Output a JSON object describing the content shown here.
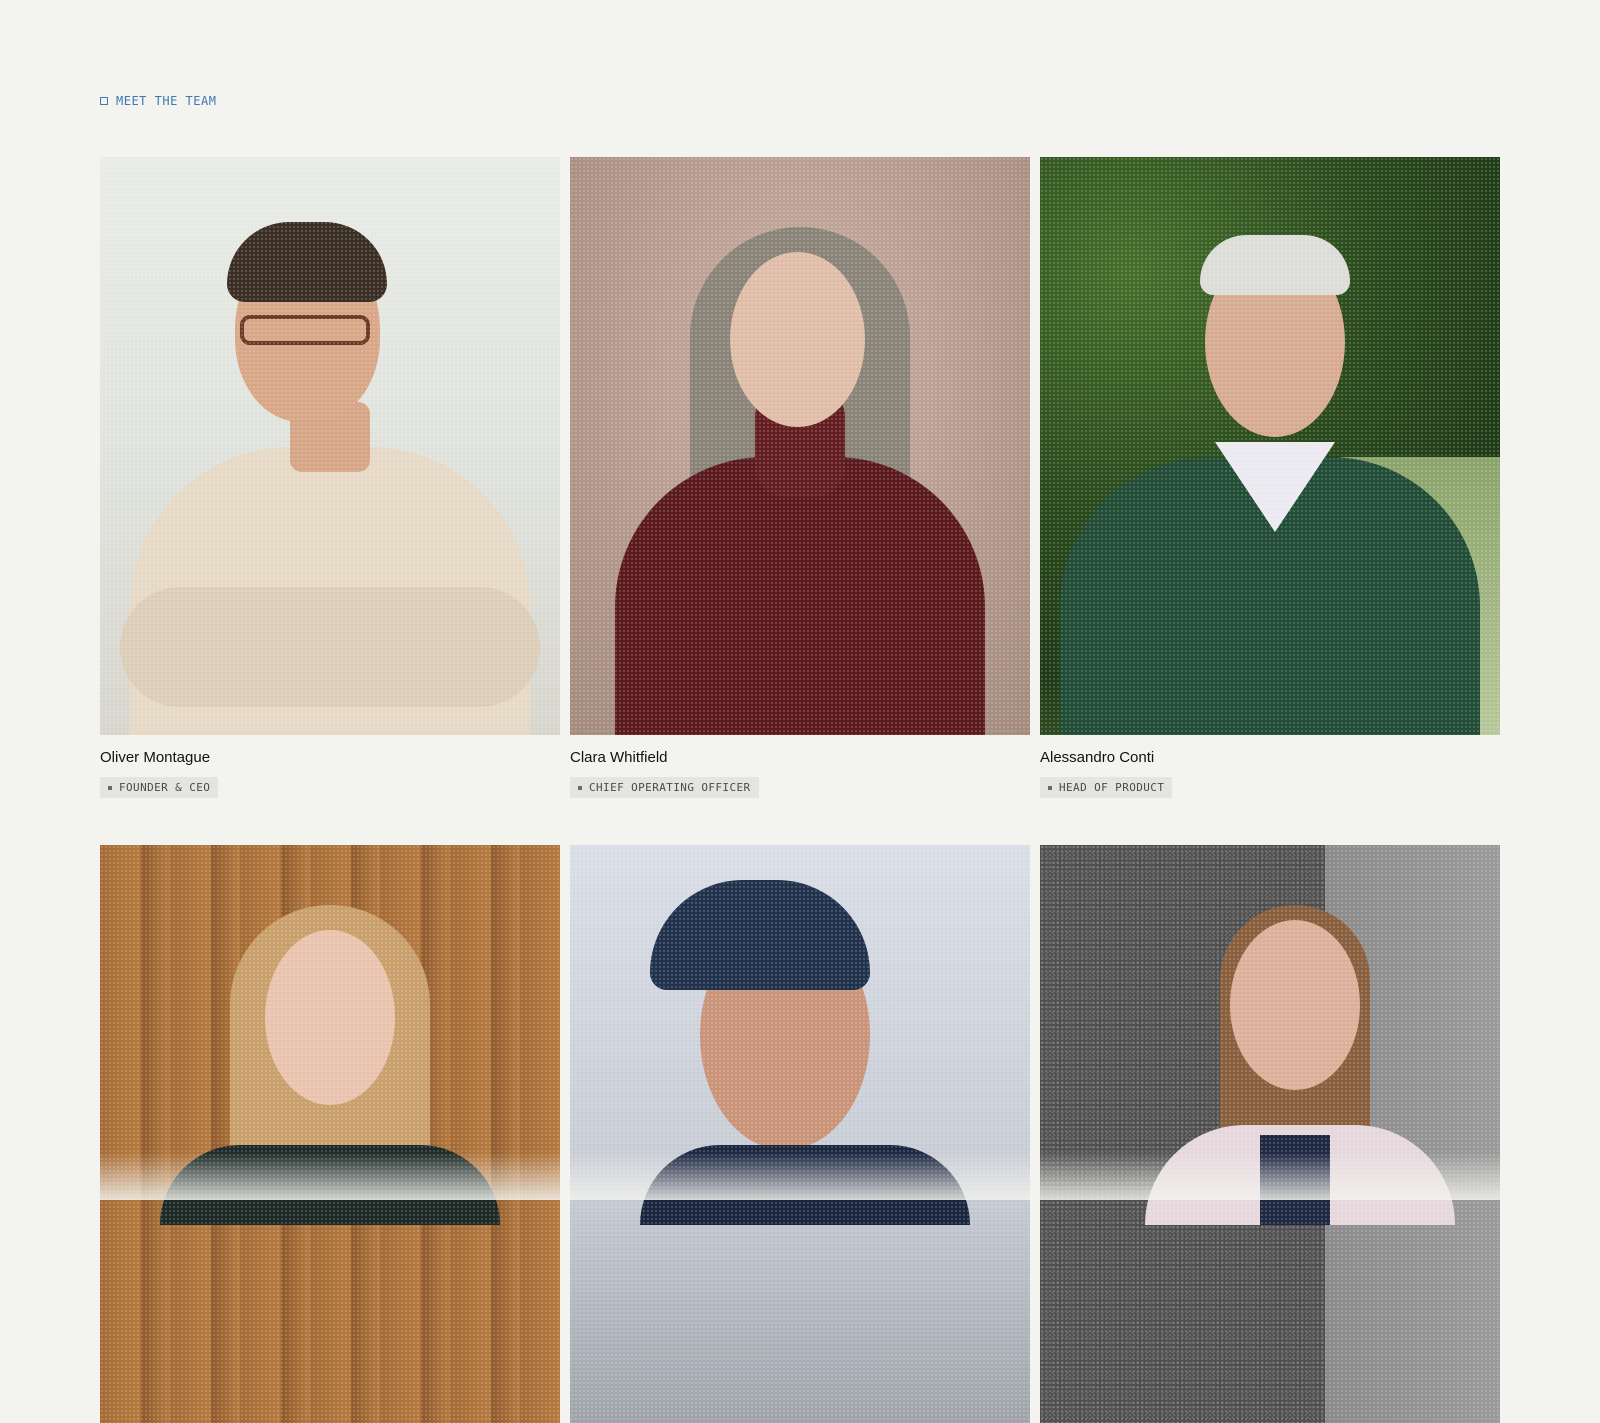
{
  "section": {
    "eyebrow_label": "MEET THE TEAM"
  },
  "team": [
    {
      "name": "Oliver Montague",
      "role": "FOUNDER & CEO"
    },
    {
      "name": "Clara Whitfield",
      "role": "CHIEF OPERATING OFFICER"
    },
    {
      "name": "Alessandro Conti",
      "role": "HEAD OF PRODUCT"
    },
    {
      "name": "",
      "role": ""
    },
    {
      "name": "",
      "role": ""
    },
    {
      "name": "",
      "role": ""
    }
  ],
  "colors": {
    "background": "#f3f4ef",
    "accent": "#3f77b5",
    "role_badge_bg": "#e4e5e0"
  }
}
